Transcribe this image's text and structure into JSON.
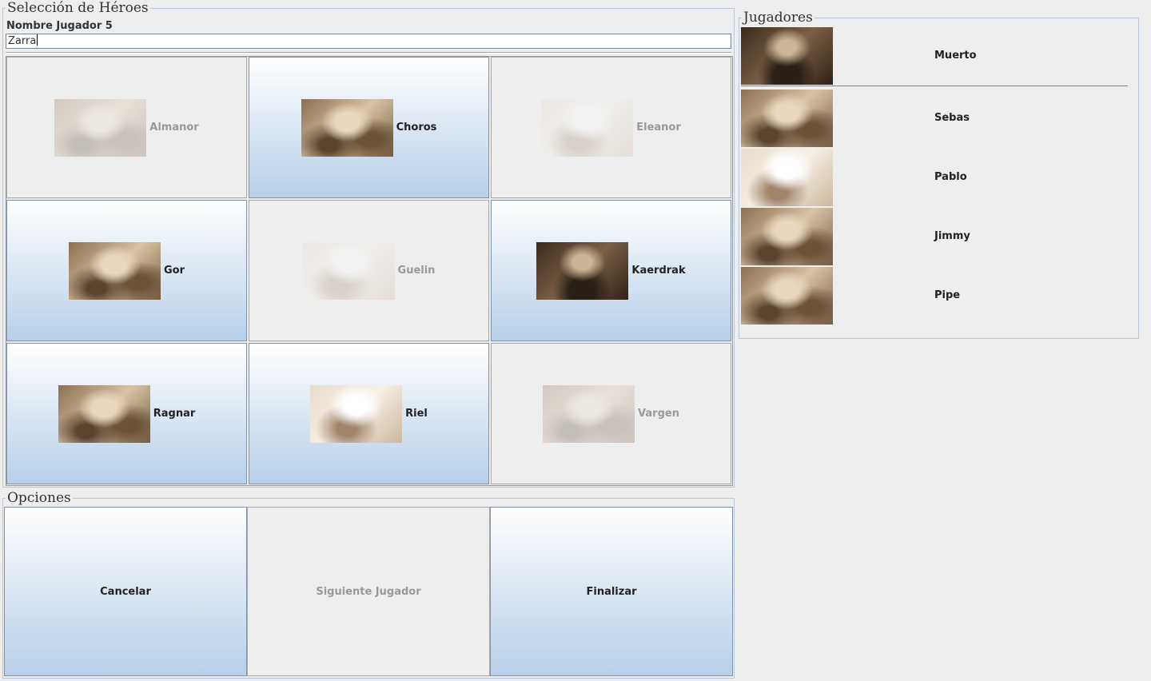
{
  "heroes_panel": {
    "title": "Selección de Héroes",
    "name_label": "Nombre Jugador 5",
    "name_value": "Zarra"
  },
  "heroes": [
    {
      "name": "Almanor",
      "available": false
    },
    {
      "name": "Choros",
      "available": true
    },
    {
      "name": "Eleanor",
      "available": false
    },
    {
      "name": "Gor",
      "available": true
    },
    {
      "name": "Guelin",
      "available": false
    },
    {
      "name": "Kaerdrak",
      "available": true
    },
    {
      "name": "Ragnar",
      "available": true
    },
    {
      "name": "Riel",
      "available": true
    },
    {
      "name": "Vargen",
      "available": false
    }
  ],
  "options_panel": {
    "title": "Opciones",
    "cancel": "Cancelar",
    "next": "Siguiente Jugador",
    "finish": "Finalizar"
  },
  "players_panel": {
    "title": "Jugadores",
    "players": [
      "Muerto",
      "Sebas",
      "Pablo",
      "Jimmy",
      "Pipe"
    ]
  }
}
